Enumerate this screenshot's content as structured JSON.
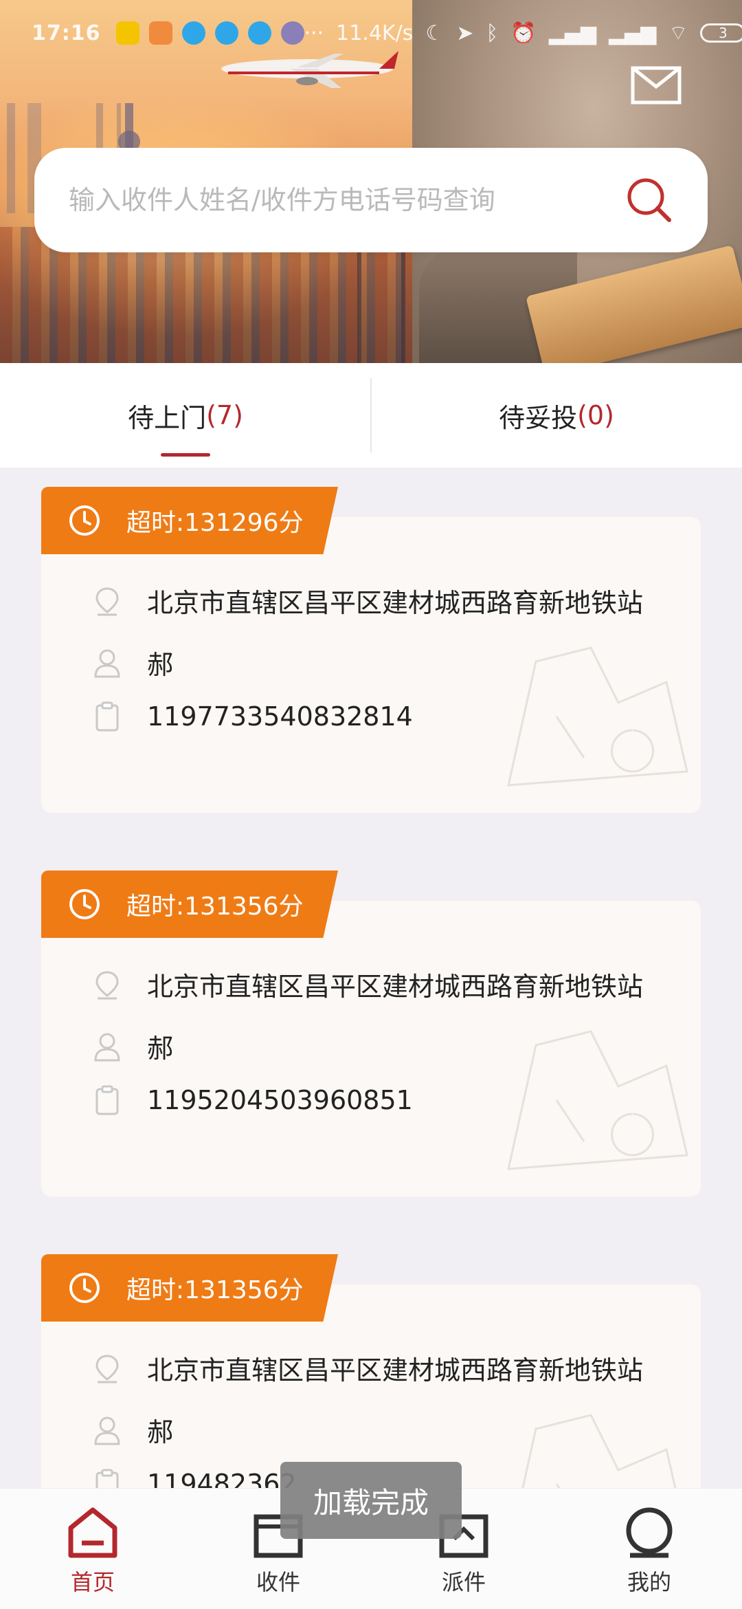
{
  "status_bar": {
    "time": "17:16",
    "network_speed": "11.4K/s",
    "battery": "3"
  },
  "header": {
    "mail_icon": "mail-icon"
  },
  "search": {
    "placeholder": "输入收件人姓名/收件方电话号码查询",
    "icon": "search-icon"
  },
  "tabs": [
    {
      "label": "待上门",
      "count": "(7)",
      "active": true
    },
    {
      "label": "待妥投",
      "count": "(0)",
      "active": false
    }
  ],
  "orders": [
    {
      "timeout": "超时:131296分",
      "address": "北京市直辖区昌平区建材城西路育新地铁站",
      "name": "郝",
      "tracking": "1197733540832814"
    },
    {
      "timeout": "超时:131356分",
      "address": "北京市直辖区昌平区建材城西路育新地铁站",
      "name": "郝",
      "tracking": "1195204503960851"
    },
    {
      "timeout": "超时:131356分",
      "address": "北京市直辖区昌平区建材城西路育新地铁站",
      "name": "郝",
      "tracking": "119482362"
    }
  ],
  "bottom_nav": [
    {
      "label": "首页",
      "icon": "home-icon",
      "active": true
    },
    {
      "label": "收件",
      "icon": "receive-icon",
      "active": false
    },
    {
      "label": "派件",
      "icon": "dispatch-icon",
      "active": false
    },
    {
      "label": "我的",
      "icon": "profile-icon",
      "active": false
    }
  ],
  "toast": "加载完成",
  "colors": {
    "accent": "#b3282d",
    "timeout_tag": "#ef7b15"
  }
}
